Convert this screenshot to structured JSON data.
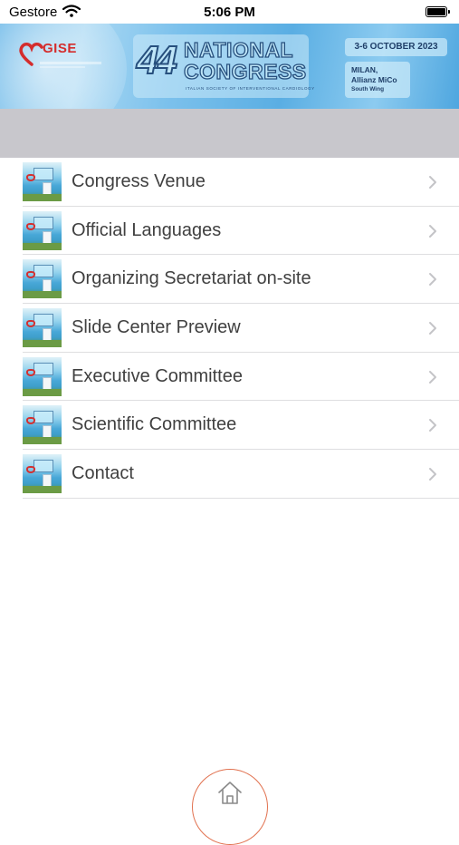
{
  "status_bar": {
    "carrier": "Gestore",
    "time": "5:06 PM"
  },
  "banner": {
    "logo_text": "GISE",
    "congress_number": "44",
    "congress_title_line1": "NATIONAL",
    "congress_title_line2": "CONGRESS",
    "congress_subtitle": "ITALIAN SOCIETY OF INTERVENTIONAL CARDIOLOGY",
    "dates": "3-6 OCTOBER 2023",
    "venue_city": "MILAN,",
    "venue_name": "Allianz MiCo",
    "venue_wing": "South Wing"
  },
  "menu": {
    "items": [
      {
        "label": "Congress Venue"
      },
      {
        "label": "Official Languages"
      },
      {
        "label": "Organizing Secretariat on-site"
      },
      {
        "label": "Slide Center Preview"
      },
      {
        "label": "Executive Committee"
      },
      {
        "label": "Scientific Committee"
      },
      {
        "label": "Contact"
      }
    ]
  },
  "icons": {
    "wifi": "wifi-icon",
    "battery": "battery-icon",
    "chevron": "chevron-right-icon",
    "home": "home-icon"
  },
  "colors": {
    "home_ring": "#e1714f",
    "logo_red": "#d42d2d",
    "banner_blue": "#5fb2e6",
    "gray_band": "#c8c7cc"
  }
}
